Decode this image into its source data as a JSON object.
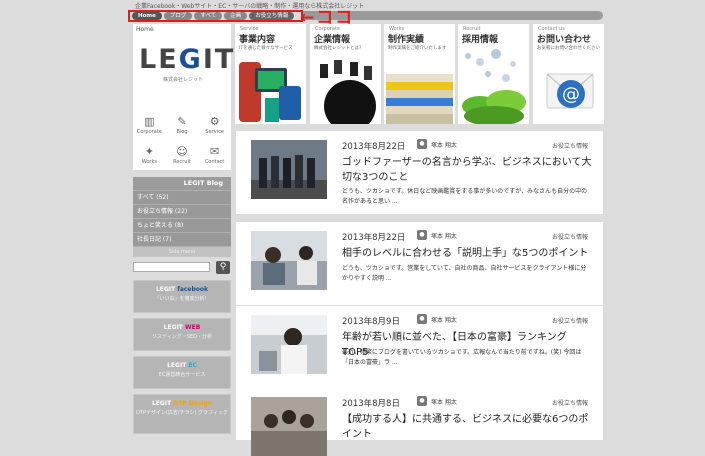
{
  "tagline": "企業Facebook・Webサイト・EC・サーバの戦略・制作・運用なら株式会社レジット",
  "breadcrumb": [
    "Home",
    "ブログ",
    "すべて",
    "企画",
    "お役立ち情報"
  ],
  "annotation": "←ココ",
  "logo": {
    "home": "Home",
    "text_before": "LE",
    "text_mid": "G",
    "text_after": "IT",
    "sub": "株式会社レジット"
  },
  "nav_icons": [
    {
      "label": "Corporate",
      "icon": "building-icon",
      "sym": "▥"
    },
    {
      "label": "Blog",
      "icon": "pencil-icon",
      "sym": "✎"
    },
    {
      "label": "Service",
      "icon": "gear-icon",
      "sym": "⚙"
    },
    {
      "label": "Works",
      "icon": "works-icon",
      "sym": "✦"
    },
    {
      "label": "Recruit",
      "icon": "smile-icon",
      "sym": "☺"
    },
    {
      "label": "Contact",
      "icon": "mail-icon",
      "sym": "✉"
    }
  ],
  "blog_categories": {
    "header_brand": "LEGIT",
    "header_word": "Blog",
    "items": [
      "すべて (52)",
      "お役立ち情報 (22)",
      "ちょと笑える (8)",
      "社長日記 (7)"
    ],
    "footer": "Side menu"
  },
  "banners": [
    {
      "brand": "LEGIT",
      "word": "facebook",
      "word_color": "#1b4f91",
      "sub": "「いいね」を徹底分析！"
    },
    {
      "brand": "LEGIT",
      "word": "WEB",
      "word_color": "#d0006f",
      "sub": "リスティング・SEO・分析"
    },
    {
      "brand": "LEGIT",
      "word": "EC",
      "word_color": "#2fa3d8",
      "sub": "EC運営統合サービス"
    },
    {
      "brand": "LEGIT",
      "word": "DTP Design",
      "word_color": "#f5a400",
      "sub": "DTPデザイン(広告/チラシ) グラフィック"
    }
  ],
  "menu_cards": [
    {
      "en": "Service",
      "jp": "事業内容",
      "desc": "ITを通じた様々なサービス"
    },
    {
      "en": "Corporate",
      "jp": "企業情報",
      "desc": "株式会社レジットとは？"
    },
    {
      "en": "Works",
      "jp": "制作実績",
      "desc": "制作実績をご紹介いたします"
    },
    {
      "en": "Recruit",
      "jp": "採用情報",
      "desc": ""
    },
    {
      "en": "Contact us",
      "jp": "お問い合わせ",
      "desc": "お気軽にお問い合わせください"
    }
  ],
  "posts": [
    {
      "date": "2013年8月22日",
      "author": "塚本 翔太",
      "category": "お役立ち情報",
      "title": "ゴッドファーザーの名言から学ぶ、ビジネスにおいて大切な3つのこと",
      "excerpt": "どうも、ツカショです。休日など映画鑑賞をする事が多いのですが、みなさんも自分の中の名作があると思い ..."
    },
    {
      "date": "2013年8月22日",
      "author": "塚本 翔太",
      "category": "お役立ち情報",
      "title": "相手のレベルに合わせる「説明上手」な5つのポイント",
      "excerpt": "どうも、ツカショです。営業をしていて、自社の商品、自社サービスをクライアント様に分かりやすく説明 ..."
    },
    {
      "date": "2013年8月9日",
      "author": "塚本 翔太",
      "category": "お役立ち情報",
      "title": "年齢が若い順に並べた、【日本の富豪】ランキングTOP5",
      "excerpt": "最近、頻繁にブログを書いているツカショです。広報なんで当たり前ですね。(笑) 今回は「日本の富豪」ラ ..."
    },
    {
      "date": "2013年8月8日",
      "author": "塚本 翔太",
      "category": "お役立ち情報",
      "title": "【成功する人】に共通する、ビジネスに必要な6つのポイント",
      "excerpt": ""
    }
  ]
}
